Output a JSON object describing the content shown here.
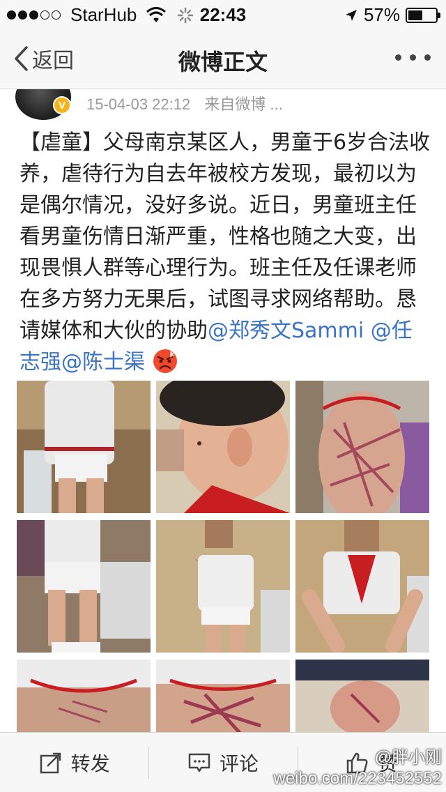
{
  "status_bar": {
    "carrier": "StarHub",
    "time": "22:43",
    "battery_level": 0.57,
    "battery_label": "57%"
  },
  "nav": {
    "back_label": "返回",
    "title": "微博正文"
  },
  "post": {
    "timestamp": "15-04-03 22:12",
    "source": "来自微博 ...",
    "text_main": "【虐童】父母南京某区人，男童于6岁合法收养，虐待行为自去年被校方发现，最初以为是偶尔情况，没好多说。近日，男童班主任看男童伤情日渐严重，性格也随之大变，出现畏惧人群等心理行为。班主任及任课老师在多方努力无果后，试图寻求网络帮助。恳请媒体和大伙的协助",
    "mentions": [
      "@郑秀文Sammi",
      "@任志强",
      "@陈士渠"
    ],
    "emoji": "angry-face-icon"
  },
  "toolbar": {
    "repost_label": "转发",
    "comment_label": "评论",
    "like_label": "赞"
  },
  "watermark": {
    "handle": "@胖小刚",
    "url": "weibo.com/223452552"
  },
  "colors": {
    "link": "#3a74c4",
    "badge": "#f5b31a"
  }
}
